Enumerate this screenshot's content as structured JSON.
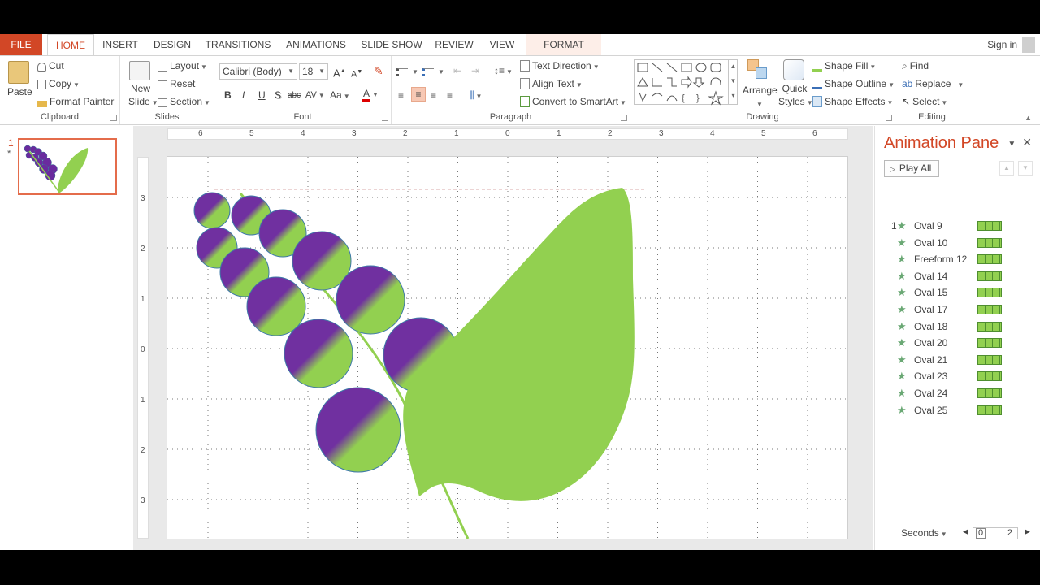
{
  "tabs": {
    "file": "FILE",
    "home": "HOME",
    "insert": "INSERT",
    "design": "DESIGN",
    "transitions": "TRANSITIONS",
    "animations": "ANIMATIONS",
    "slideshow": "SLIDE SHOW",
    "review": "REVIEW",
    "view": "VIEW",
    "format": "FORMAT"
  },
  "signin": "Sign in",
  "clipboard": {
    "label": "Clipboard",
    "paste": "Paste",
    "cut": "Cut",
    "copy": "Copy",
    "format_painter": "Format Painter"
  },
  "slides": {
    "label": "Slides",
    "new_slide_1": "New",
    "new_slide_2": "Slide",
    "layout": "Layout",
    "reset": "Reset",
    "section": "Section"
  },
  "font": {
    "label": "Font",
    "family": "Calibri (Body)",
    "size": "18",
    "bold": "B",
    "italic": "I",
    "underline": "U",
    "shadow": "S",
    "strike": "abc",
    "spacing": "AV",
    "case": "Aa",
    "color": "A",
    "grow": "A",
    "shrink": "A"
  },
  "paragraph": {
    "label": "Paragraph",
    "text_direction": "Text Direction",
    "align_text": "Align Text",
    "convert_smartart": "Convert to SmartArt"
  },
  "drawing": {
    "label": "Drawing",
    "arrange": "Arrange",
    "quick_styles_1": "Quick",
    "quick_styles_2": "Styles",
    "shape_fill": "Shape Fill",
    "shape_outline": "Shape Outline",
    "shape_effects": "Shape Effects"
  },
  "editing": {
    "label": "Editing",
    "find": "Find",
    "replace": "Replace",
    "select": "Select"
  },
  "thumbnails": {
    "number": "1",
    "star": "*"
  },
  "ruler": {
    "h": [
      "6",
      "5",
      "4",
      "3",
      "2",
      "1",
      "0",
      "1",
      "2",
      "3",
      "4",
      "5",
      "6"
    ],
    "v": [
      "3",
      "2",
      "1",
      "0",
      "1",
      "2",
      "3"
    ]
  },
  "animation_pane": {
    "title": "Animation Pane",
    "play_all": "Play All",
    "items": [
      {
        "num": "1",
        "name": "Oval 9"
      },
      {
        "num": "",
        "name": "Oval 10"
      },
      {
        "num": "",
        "name": "Freeform 12"
      },
      {
        "num": "",
        "name": "Oval 14"
      },
      {
        "num": "",
        "name": "Oval 15"
      },
      {
        "num": "",
        "name": "Oval 17"
      },
      {
        "num": "",
        "name": "Oval 18"
      },
      {
        "num": "",
        "name": "Oval 20"
      },
      {
        "num": "",
        "name": "Oval 21"
      },
      {
        "num": "",
        "name": "Oval 23"
      },
      {
        "num": "",
        "name": "Oval 24"
      },
      {
        "num": "",
        "name": "Oval 25"
      }
    ],
    "seconds": "Seconds",
    "timeline_start": "0",
    "timeline_end": "2"
  },
  "colors": {
    "accent": "#d24726",
    "leaf": "#92d050",
    "grape": "#7030a0",
    "anim_bar": "#92d050"
  }
}
